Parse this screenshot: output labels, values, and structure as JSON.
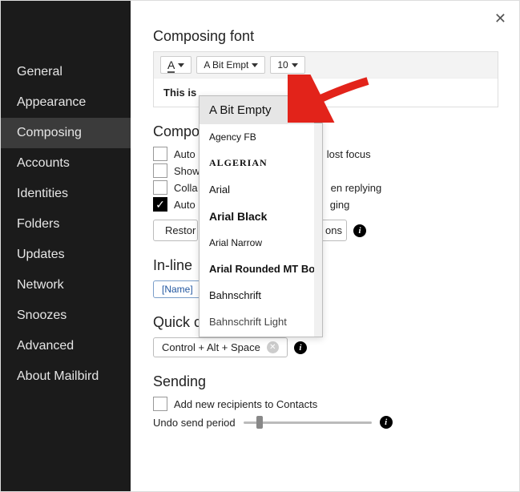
{
  "sidebar": {
    "items": [
      {
        "label": "General"
      },
      {
        "label": "Appearance"
      },
      {
        "label": "Composing"
      },
      {
        "label": "Accounts"
      },
      {
        "label": "Identities"
      },
      {
        "label": "Folders"
      },
      {
        "label": "Updates"
      },
      {
        "label": "Network"
      },
      {
        "label": "Snoozes"
      },
      {
        "label": "Advanced"
      },
      {
        "label": "About Mailbird"
      }
    ],
    "active_index": 2
  },
  "sections": {
    "font_title": "Composing font",
    "font_selector": "A Bit Empt",
    "font_size": "10",
    "font_preview": "This is",
    "compose_title": "Compo",
    "compose_checks": [
      {
        "label_left": "Auto",
        "label_right": "lost focus",
        "checked": false
      },
      {
        "label_left": "Show",
        "label_right": "",
        "checked": false
      },
      {
        "label_left": "Colla",
        "label_right": "en replying",
        "checked": false
      },
      {
        "label_left": "Auto",
        "label_right": "ging",
        "checked": true
      }
    ],
    "restore_btn": "Restor",
    "options_btn": "ons",
    "inline_title": "In-line",
    "inline_tag": "[Name]",
    "shortcut_title": "Quick compose shortcut",
    "shortcut_value": "Control + Alt + Space",
    "sending_title": "Sending",
    "sending_check": "Add new recipients to Contacts",
    "undo_label": "Undo send period"
  },
  "dropdown": {
    "items": [
      {
        "label": "A Bit Empty",
        "style": "normal",
        "selected": true
      },
      {
        "label": "Agency FB",
        "style": "narrow"
      },
      {
        "label": "ALGERIAN",
        "style": "algerian"
      },
      {
        "label": "Arial",
        "style": "arial"
      },
      {
        "label": "Arial Black",
        "style": "black"
      },
      {
        "label": "Arial Narrow",
        "style": "arialnarrow"
      },
      {
        "label": "Arial Rounded MT Bold",
        "style": "roundbold"
      },
      {
        "label": "Bahnschrift",
        "style": "bahn"
      },
      {
        "label": "Bahnschrift Light",
        "style": "bahnlight"
      }
    ]
  }
}
